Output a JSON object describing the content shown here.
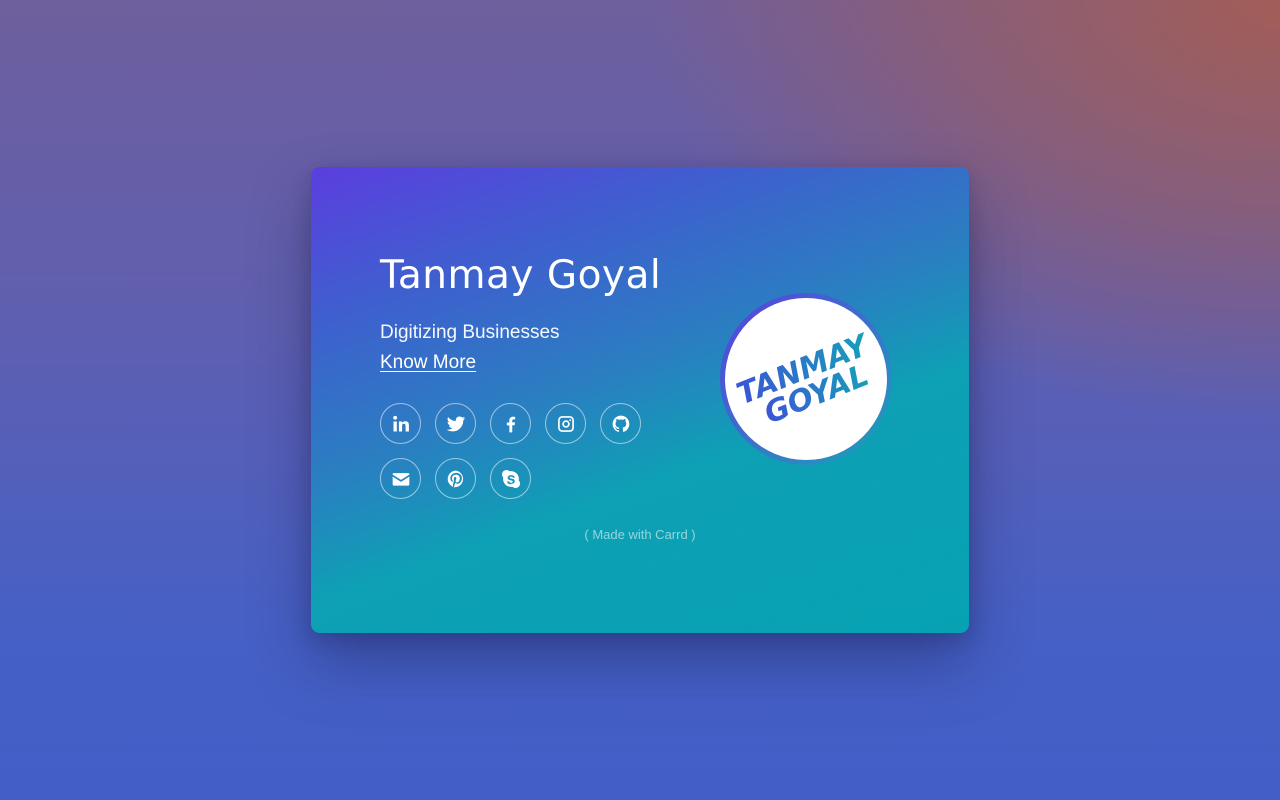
{
  "profile": {
    "name": "Tanmay Goyal",
    "tagline": "Digitizing Businesses",
    "link_label": "Know More"
  },
  "social": {
    "row1": [
      {
        "name": "linkedin-icon"
      },
      {
        "name": "twitter-icon"
      },
      {
        "name": "facebook-icon"
      },
      {
        "name": "instagram-icon"
      },
      {
        "name": "github-icon"
      }
    ],
    "row2": [
      {
        "name": "email-icon"
      },
      {
        "name": "pinterest-icon"
      },
      {
        "name": "skype-icon"
      }
    ]
  },
  "footer": {
    "credit": "( Made with Carrd )"
  },
  "logo": {
    "line1": "TANMAY",
    "line2": "GOYAL"
  },
  "colors": {
    "card_top": "#5b3edf",
    "card_bottom": "#06a2b3",
    "logo_purple": "#5b3edf",
    "logo_teal": "#1aa3b8"
  }
}
